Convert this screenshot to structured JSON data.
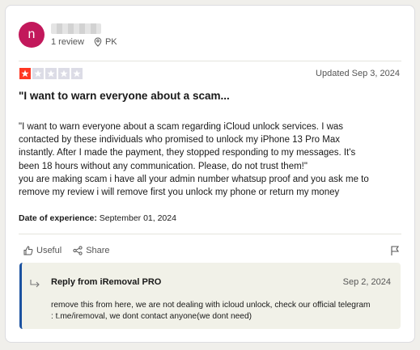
{
  "reviewer": {
    "avatar_initial": "n",
    "reviews_count": "1 review",
    "country": "PK"
  },
  "review": {
    "rating": 1,
    "max_rating": 5,
    "updated": "Updated Sep 3, 2024",
    "title": "\"I want to warn everyone about a scam...",
    "body_lines": [
      "\"I want to warn everyone about a scam regarding iCloud unlock services. I was",
      "contacted by these individuals who promised to unlock my iPhone 13 Pro Max",
      "instantly. After I made the payment, they stopped responding to my messages. It's",
      "been 18 hours without any communication. Please, do not trust them!\"",
      "you are making scam i have all your admin number whatsup proof and you ask me to",
      "remove my review i will remove first you unlock my phone or return my money"
    ],
    "experience_label": "Date of experience:",
    "experience_date": "September 01, 2024"
  },
  "actions": {
    "useful_label": "Useful",
    "share_label": "Share"
  },
  "reply": {
    "from": "Reply from iRemoval PRO",
    "date": "Sep 2, 2024",
    "lines": [
      "remove this from here, we are not dealing with icloud unlock, check our official telegram",
      ": t.me/iremoval, we dont contact anyone(we dont need)"
    ]
  },
  "colors": {
    "star_filled": "#ff3722",
    "star_empty": "#dcdce6",
    "avatar_bg": "#c2185b",
    "reply_accent": "#1c52a0"
  }
}
